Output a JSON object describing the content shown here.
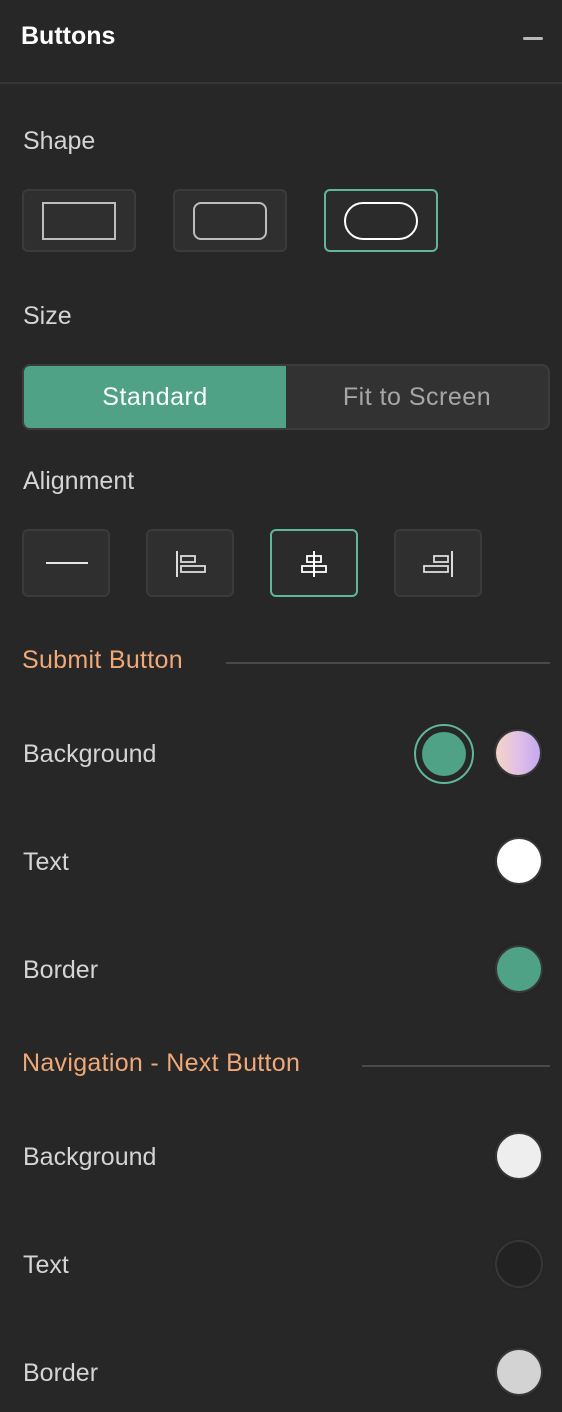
{
  "panel": {
    "title": "Buttons",
    "collapse_icon": "minus-icon"
  },
  "shape": {
    "label": "Shape",
    "options": [
      {
        "name": "rectangle"
      },
      {
        "name": "rounded"
      },
      {
        "name": "pill",
        "selected": true
      }
    ]
  },
  "size": {
    "label": "Size",
    "options": [
      "Standard",
      "Fit to Screen"
    ],
    "selected": "Standard"
  },
  "alignment": {
    "label": "Alignment",
    "options": [
      "full-width",
      "left",
      "center",
      "right"
    ],
    "selected": "center"
  },
  "submit_button": {
    "heading": "Submit Button",
    "background": {
      "label": "Background",
      "colors": [
        "#4fa285",
        "gradient-peach-lavender"
      ],
      "selected": "#4fa285"
    },
    "text": {
      "label": "Text",
      "color": "#ffffff"
    },
    "border": {
      "label": "Border",
      "color": "#4fa285"
    }
  },
  "next_button": {
    "heading": "Navigation - Next Button",
    "background": {
      "label": "Background",
      "color": "#eeeeee"
    },
    "text": {
      "label": "Text",
      "color": "#222222"
    },
    "border": {
      "label": "Border",
      "color": "#d3d3d3"
    }
  },
  "colors": {
    "accent": "#4fa285",
    "section_heading": "#f0a878",
    "panel_bg": "#272727"
  }
}
